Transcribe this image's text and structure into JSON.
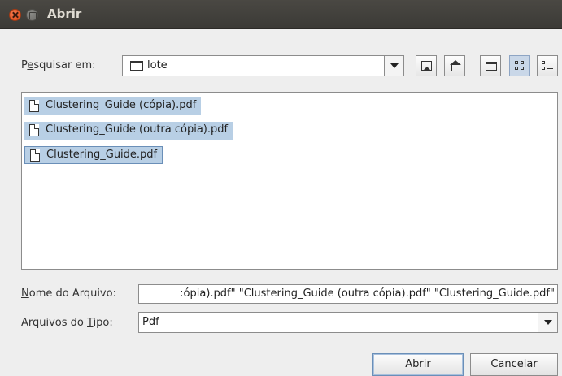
{
  "window": {
    "title": "Abrir"
  },
  "look_in": {
    "label_pre": "P",
    "label_mnemonic": "e",
    "label_post": "squisar em:",
    "value": "lote"
  },
  "toolbar": {
    "icons": [
      "up-folder-icon",
      "home-icon",
      "new-folder-icon",
      "list-view-icon",
      "details-view-icon"
    ]
  },
  "files": [
    {
      "name": "Clustering_Guide (cópia).pdf",
      "selected": true
    },
    {
      "name": "Clustering_Guide (outra cópia).pdf",
      "selected": true
    },
    {
      "name": "Clustering_Guide.pdf",
      "selected": true,
      "focused": true
    }
  ],
  "file_name": {
    "label_mnemonic": "N",
    "label_post": "ome do Arquivo:",
    "value": ":ópia).pdf\" \"Clustering_Guide (outra cópia).pdf\" \"Clustering_Guide.pdf\""
  },
  "file_type": {
    "label_pre": "Arquivos do ",
    "label_mnemonic": "T",
    "label_post": "ipo:",
    "value": "Pdf"
  },
  "buttons": {
    "open": "Abrir",
    "cancel": "Cancelar"
  }
}
